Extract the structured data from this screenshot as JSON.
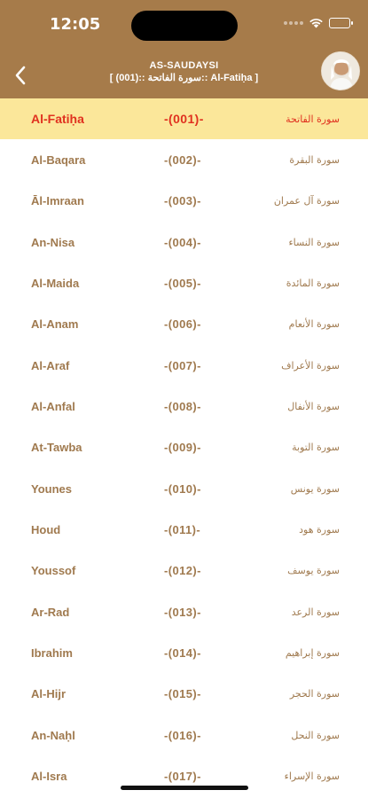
{
  "status_bar": {
    "time": "12:05"
  },
  "header": {
    "reciter": "AS-SAUDAYSI",
    "current_track": "[ سورة الفاتحة ::(001):: Al-Fatiḥa ]"
  },
  "colors": {
    "header_bg": "#a67b4a",
    "selected_bg": "#fbe79a",
    "selected_text": "#e0311f",
    "row_text": "#a07a4f"
  },
  "surahs": [
    {
      "en": "Al-Fatiḥa",
      "num": "-(001)-",
      "ar": "سورة الفاتحة",
      "selected": true
    },
    {
      "en": "Al-Baqara",
      "num": "-(002)-",
      "ar": "سورة البقرة"
    },
    {
      "en": "Āl-Imraan",
      "num": "-(003)-",
      "ar": "سورة آل عمران"
    },
    {
      "en": "An-Nisa",
      "num": "-(004)-",
      "ar": "سورة النساء"
    },
    {
      "en": "Al-Maida",
      "num": "-(005)-",
      "ar": "سورة المائدة"
    },
    {
      "en": "Al-Anam",
      "num": "-(006)-",
      "ar": "سورة الأنعام"
    },
    {
      "en": "Al-Araf",
      "num": "-(007)-",
      "ar": "سورة الأعراف"
    },
    {
      "en": "Al-Anfal",
      "num": "-(008)-",
      "ar": "سورة الأنفال"
    },
    {
      "en": "At-Tawba",
      "num": "-(009)-",
      "ar": "سورة التوبة"
    },
    {
      "en": "Younes",
      "num": "-(010)-",
      "ar": "سورة يونس"
    },
    {
      "en": "Houd",
      "num": "-(011)-",
      "ar": "سورة هود"
    },
    {
      "en": "Youssof",
      "num": "-(012)-",
      "ar": "سورة يوسف"
    },
    {
      "en": "Ar-Rad",
      "num": "-(013)-",
      "ar": "سورة الرعد"
    },
    {
      "en": "Ibrahim",
      "num": "-(014)-",
      "ar": "سورة إبراهيم"
    },
    {
      "en": "Al-Hijr",
      "num": "-(015)-",
      "ar": "سورة الحجر"
    },
    {
      "en": "An-Naḥl",
      "num": "-(016)-",
      "ar": "سورة النحل"
    },
    {
      "en": "Al-Isra",
      "num": "-(017)-",
      "ar": "سورة الإسراء"
    }
  ]
}
